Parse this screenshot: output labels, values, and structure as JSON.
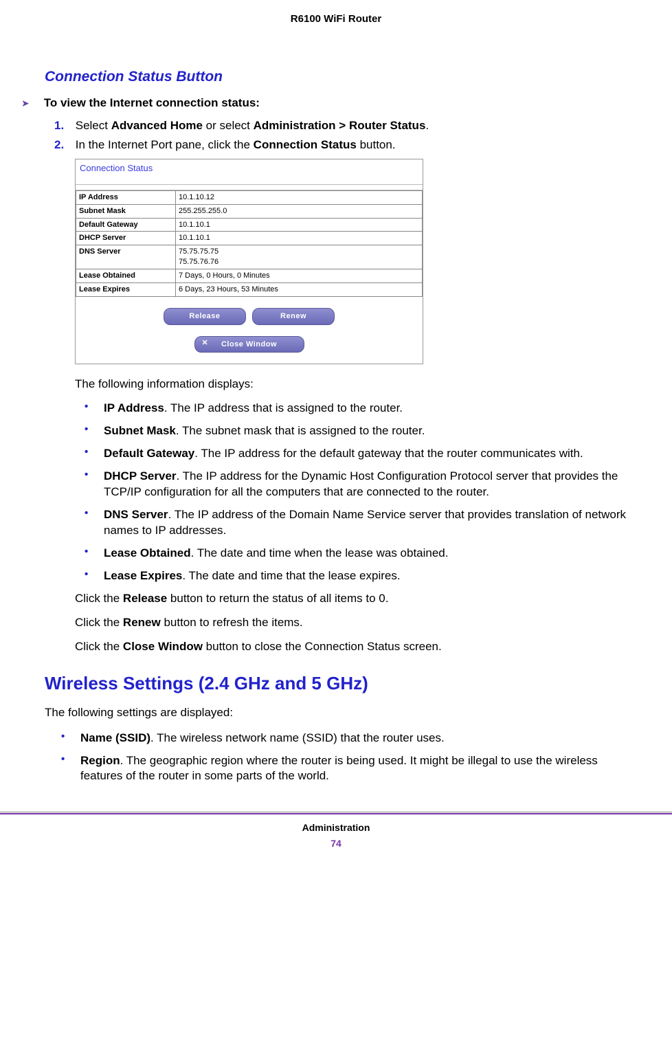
{
  "header": {
    "title": "R6100 WiFi Router"
  },
  "subheading": "Connection Status Button",
  "task": {
    "text": "To view the Internet connection status:"
  },
  "steps": [
    {
      "num": "1.",
      "pre": "Select ",
      "b1": "Advanced Home",
      "mid": " or select ",
      "b2": "Administration > Router Status",
      "post": "."
    },
    {
      "num": "2.",
      "pre": "In the Internet Port pane, click the ",
      "b1": "Connection Status",
      "post": " button."
    }
  ],
  "screenshot": {
    "title": "Connection Status",
    "rows": [
      {
        "label": "IP Address",
        "value": "10.1.10.12"
      },
      {
        "label": "Subnet Mask",
        "value": "255.255.255.0"
      },
      {
        "label": "Default Gateway",
        "value": "10.1.10.1"
      },
      {
        "label": "DHCP Server",
        "value": "10.1.10.1"
      },
      {
        "label": "DNS Server",
        "value": "75.75.75.75\n75.75.76.76"
      },
      {
        "label": "Lease Obtained",
        "value": "7 Days, 0 Hours, 0 Minutes"
      },
      {
        "label": "Lease Expires",
        "value": "6 Days, 23 Hours, 53 Minutes"
      }
    ],
    "buttons": {
      "release": "Release",
      "renew": "Renew",
      "close": "Close Window"
    }
  },
  "intro": "The following information displays:",
  "fields": [
    {
      "label": "IP Address",
      "desc": ". The IP address that is assigned to the router."
    },
    {
      "label": "Subnet Mask",
      "desc": ". The subnet mask that is assigned to the router."
    },
    {
      "label": "Default Gateway",
      "desc": ". The IP address for the default gateway that the router communicates with."
    },
    {
      "label": "DHCP Server",
      "desc": ". The IP address for the Dynamic Host Configuration Protocol server that provides the TCP/IP configuration for all the computers that are connected to the router."
    },
    {
      "label": "DNS Server",
      "desc": ". The IP address of the Domain Name Service server that provides translation of network names to IP addresses."
    },
    {
      "label": "Lease Obtained",
      "desc": ". The date and time when the lease was obtained."
    },
    {
      "label": "Lease Expires",
      "desc": ". The date and time that the lease expires."
    }
  ],
  "paras": [
    {
      "pre": "Click the ",
      "b": "Release",
      "post": " button to return the status of all items to 0."
    },
    {
      "pre": "Click the ",
      "b": "Renew",
      "post": " button to refresh the items."
    },
    {
      "pre": "Click the ",
      "b": "Close Window",
      "post": " button to close the Connection Status screen."
    }
  ],
  "section2": {
    "heading": "Wireless Settings (2.4 GHz and 5 GHz)",
    "intro": "The following settings are displayed:",
    "bullets": [
      {
        "label": "Name (SSID)",
        "desc": ". The wireless network name (SSID) that the router uses."
      },
      {
        "label": "Region",
        "desc": ". The geographic region where the router is being used. It might be illegal to use the wireless features of the router in some parts of the world."
      }
    ]
  },
  "footer": {
    "section": "Administration",
    "page": "74"
  }
}
